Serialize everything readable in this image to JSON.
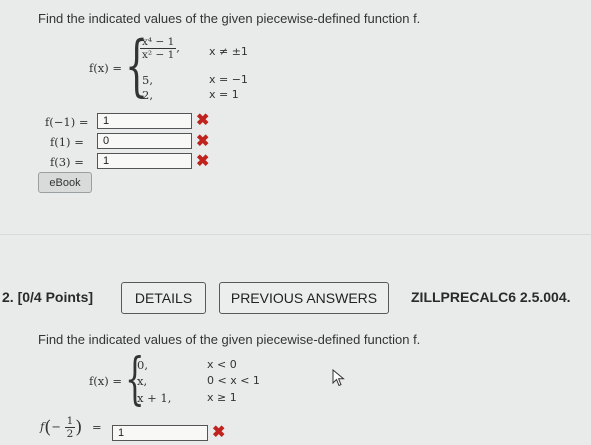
{
  "q1": {
    "prompt": "Find the indicated values of the given piecewise-defined function f.",
    "func_label": "f(x) =",
    "piece1_num": "x⁴ − 1",
    "piece1_den": "x² − 1",
    "piece1_cond": "x ≠ ±1",
    "piece2_expr": "5,",
    "piece2_cond": "x = −1",
    "piece3_expr": "2,",
    "piece3_cond": "x = 1",
    "rows": [
      {
        "label": "f(−1) =",
        "value": "1"
      },
      {
        "label": "f(1) =",
        "value": "0"
      },
      {
        "label": "f(3) =",
        "value": "1"
      }
    ],
    "ebook_label": "eBook"
  },
  "q2": {
    "points_label": "2. [0/4 Points]",
    "details_label": "DETAILS",
    "previous_answers_label": "PREVIOUS ANSWERS",
    "source_label": "ZILLPRECALC6 2.5.004.",
    "prompt": "Find the indicated values of the given piecewise-defined function f.",
    "func_label": "f(x) =",
    "piece1_expr": "0,",
    "piece1_cond": "x < 0",
    "piece2_expr": "x,",
    "piece2_cond": "0 < x < 1",
    "piece3_expr": "x + 1,",
    "piece3_cond": "x ≥ 1",
    "eval_f": "f",
    "eval_num": "1",
    "eval_den": "2",
    "eval_sign": "−",
    "eval_eq": "=",
    "answer": "1"
  },
  "icons": {
    "wrong": "x-mark-icon",
    "cursor": "mouse-pointer-icon"
  },
  "colors": {
    "wrong": "#c0221e",
    "background": "#e9ebea"
  }
}
